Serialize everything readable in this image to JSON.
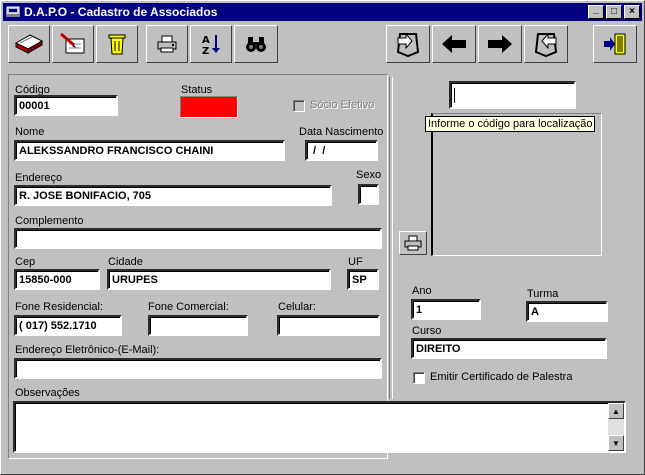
{
  "window": {
    "title": "D.A.P.O - Cadastro de Associados",
    "minimize_label": "_",
    "maximize_label": "□",
    "close_label": "×"
  },
  "toolbar": [
    {
      "name": "new-record-icon"
    },
    {
      "name": "edit-record-icon"
    },
    {
      "name": "trash-icon"
    },
    {
      "name": "print-icon"
    },
    {
      "name": "sort-az-icon",
      "label_a": "A",
      "label_z": "Z"
    },
    {
      "name": "binoculars-icon"
    },
    {
      "name": "first-record-icon"
    },
    {
      "name": "previous-record-icon"
    },
    {
      "name": "next-record-icon"
    },
    {
      "name": "last-record-icon"
    },
    {
      "name": "exit-door-icon"
    }
  ],
  "form": {
    "codigo": {
      "label": "Código",
      "value": "00001"
    },
    "status": {
      "label": "Status",
      "color": "#ff0000"
    },
    "socio_efetivo": {
      "label": "Sócio Efetivo"
    },
    "nome": {
      "label": "Nome",
      "value": "ALEKSSANDRO FRANCISCO CHAINI"
    },
    "data_nascimento": {
      "label": "Data Nascimento",
      "value": " /  /"
    },
    "endereco": {
      "label": "Endereço",
      "value": "R. JOSE BONIFACIO, 705"
    },
    "sexo": {
      "label": "Sexo",
      "value": ""
    },
    "complemento": {
      "label": "Complemento",
      "value": ""
    },
    "cep": {
      "label": "Cep",
      "value": "15850-000"
    },
    "cidade": {
      "label": "Cidade",
      "value": "URUPES"
    },
    "uf": {
      "label": "UF",
      "value": "SP"
    },
    "fone_residencial": {
      "label": "Fone Residencial:",
      "value": "( 017) 552.1710"
    },
    "fone_comercial": {
      "label": "Fone Comercial:",
      "value": ""
    },
    "celular": {
      "label": "Celular:",
      "value": ""
    },
    "email": {
      "label": "Endereço Eletrônico-(E-Mail):",
      "value": ""
    },
    "observacoes": {
      "label": "Observações",
      "value": ""
    }
  },
  "search": {
    "value": "",
    "tooltip": "Informe o código para localização"
  },
  "academic": {
    "ano": {
      "label": "Ano",
      "value": "1"
    },
    "turma": {
      "label": "Turma",
      "value": "A"
    },
    "curso": {
      "label": "Curso",
      "value": "DIREITO"
    },
    "certificado": {
      "label": "Emitir Certificado de Palestra"
    }
  },
  "scroll": {
    "up": "▲",
    "down": "▼"
  }
}
